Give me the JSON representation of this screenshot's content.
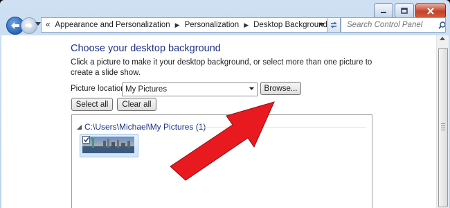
{
  "window": {
    "caption_buttons": [
      "minimize-icon",
      "maximize-icon",
      "close-icon"
    ]
  },
  "nav": {
    "address": {
      "chevrons": "«",
      "crumbs": [
        "Appearance and Personalization",
        "Personalization",
        "Desktop Background"
      ]
    },
    "search": {
      "placeholder": "Search Control Panel"
    }
  },
  "main": {
    "title": "Choose your desktop background",
    "description": "Click a picture to make it your desktop background, or select more than one picture to create a slide show.",
    "picture_location": {
      "label": "Picture location:",
      "selected": "My Pictures"
    },
    "browse_label": "Browse...",
    "select_all_label": "Select all",
    "clear_all_label": "Clear all",
    "group": {
      "label": "C:\\Users\\Michael\\My Pictures (1)",
      "items": [
        {
          "checked": true,
          "icon": "statue-of-liberty-thumbnail"
        }
      ]
    }
  },
  "colors": {
    "title_blue": "#1e3287",
    "annotation_arrow": "#e8191f"
  }
}
